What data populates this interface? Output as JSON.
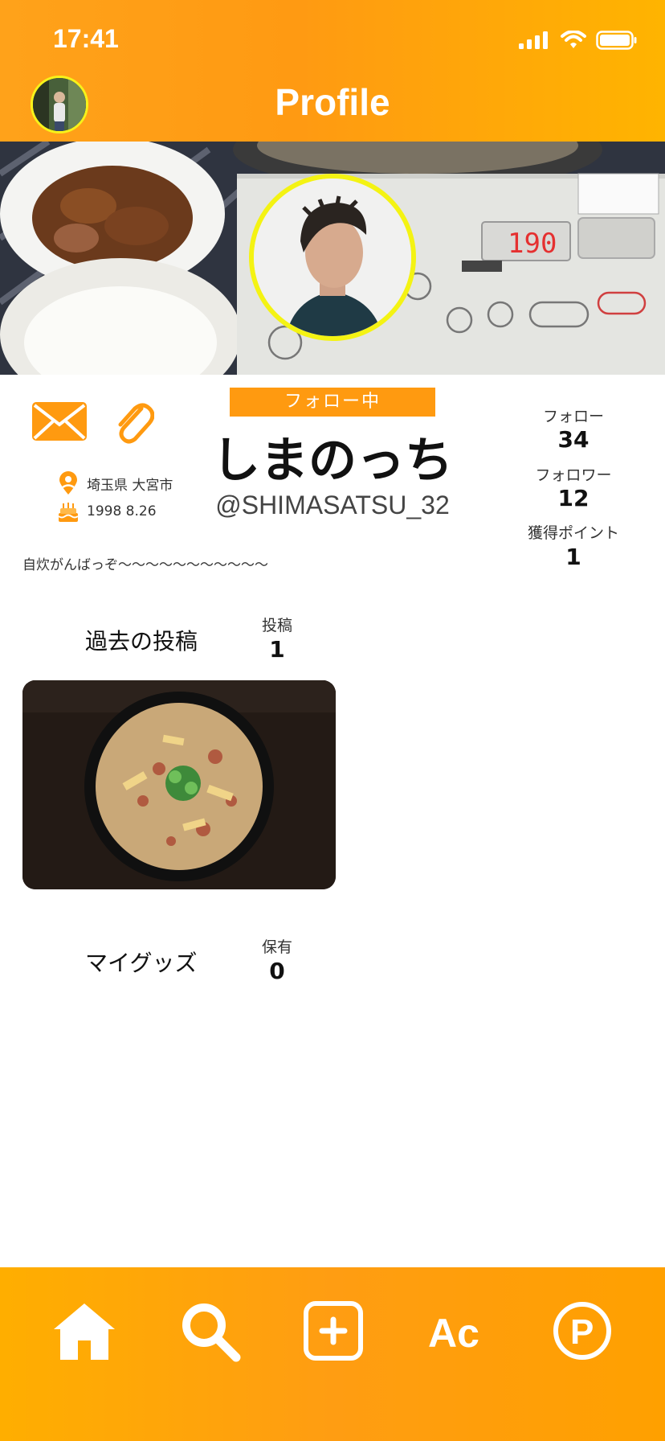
{
  "status_bar": {
    "time": "17:41"
  },
  "header": {
    "title": "Profile"
  },
  "profile": {
    "follow_button": "フォロー中",
    "display_name": "しまのっち",
    "username": "@SHIMASATSU_32",
    "location": "埼玉県 大宮市",
    "birthday": "1998 8.26",
    "bio": "自炊がんばっぞ〜〜〜〜〜〜〜〜〜〜〜"
  },
  "stats": [
    {
      "label": "フォロー",
      "value": "34"
    },
    {
      "label": "フォロワー",
      "value": "12"
    },
    {
      "label": "獲得ポイント",
      "value": "1"
    }
  ],
  "posts_section": {
    "title": "過去の投稿",
    "count_label": "投稿",
    "count": "1"
  },
  "goods_section": {
    "title": "マイグッズ",
    "count_label": "保有",
    "count": "0"
  },
  "tabs": [
    {
      "name": "home",
      "icon": "home-icon"
    },
    {
      "name": "search",
      "icon": "search-icon"
    },
    {
      "name": "add",
      "icon": "add-post-icon"
    },
    {
      "name": "account",
      "icon": "ac-icon",
      "text": "Ac"
    },
    {
      "name": "points",
      "icon": "points-icon",
      "text": "P"
    }
  ],
  "colors": {
    "accent": "#ff9a10",
    "avatar_ring": "#f4f313",
    "header_text": "#ffffff"
  }
}
